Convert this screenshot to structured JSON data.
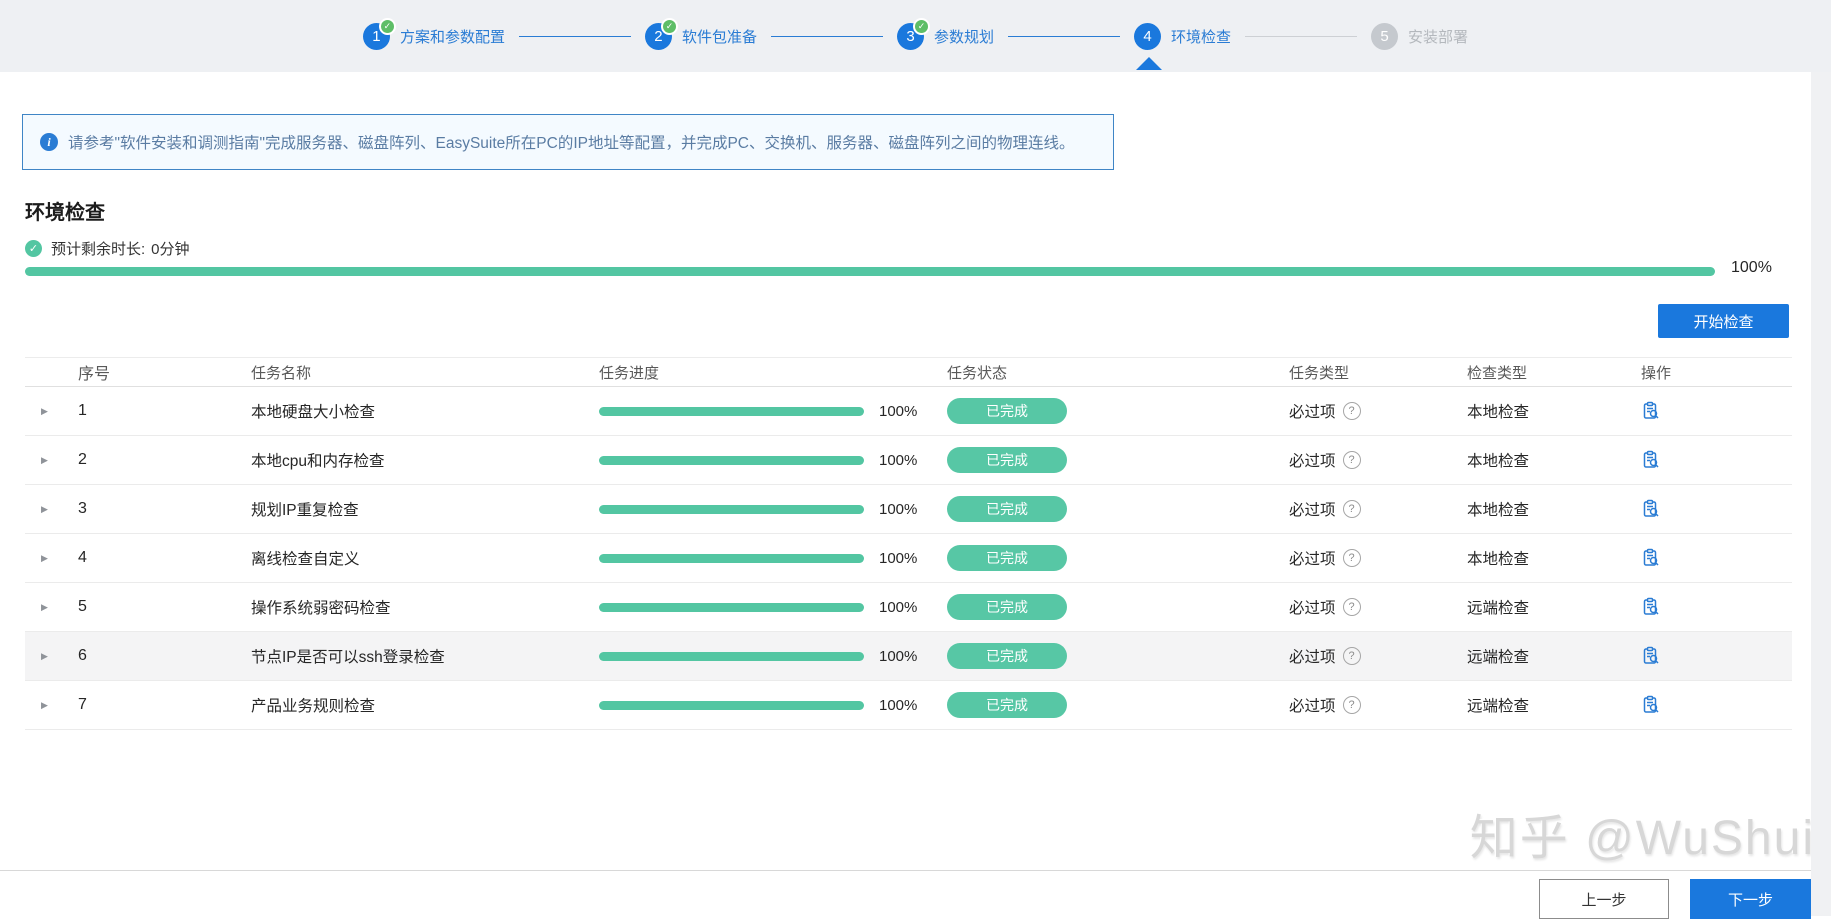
{
  "colors": {
    "primary_blue": "#1a78dd",
    "link_blue": "#2a7cd4",
    "progress_teal": "#53c6a2",
    "badge_teal": "#57c7a5",
    "step_done_green": "#5ebe67",
    "banner_border": "#3f85c6",
    "banner_bg": "#f4faff"
  },
  "stepper": {
    "steps": [
      {
        "num": "1",
        "label": "方案和参数配置",
        "state": "done"
      },
      {
        "num": "2",
        "label": "软件包准备",
        "state": "done"
      },
      {
        "num": "3",
        "label": "参数规划",
        "state": "done"
      },
      {
        "num": "4",
        "label": "环境检查",
        "state": "current"
      },
      {
        "num": "5",
        "label": "安装部署",
        "state": "pending"
      }
    ]
  },
  "banner": {
    "text": "请参考\"软件安装和调测指南\"完成服务器、磁盘阵列、EasySuite所在PC的IP地址等配置，并完成PC、交换机、服务器、磁盘阵列之间的物理连线。"
  },
  "section": {
    "title": "环境检查",
    "remaining_label": "预计剩余时长:",
    "remaining_value": "0分钟",
    "overall_progress": "100%"
  },
  "actions": {
    "start_check": "开始检查"
  },
  "table": {
    "headers": [
      "序号",
      "任务名称",
      "任务进度",
      "任务状态",
      "任务类型",
      "检查类型",
      "操作"
    ],
    "rows": [
      {
        "no": "1",
        "name": "本地硬盘大小检查",
        "progress": "100%",
        "status": "已完成",
        "type": "必过项",
        "check_type": "本地检查"
      },
      {
        "no": "2",
        "name": "本地cpu和内存检查",
        "progress": "100%",
        "status": "已完成",
        "type": "必过项",
        "check_type": "本地检查"
      },
      {
        "no": "3",
        "name": "规划IP重复检查",
        "progress": "100%",
        "status": "已完成",
        "type": "必过项",
        "check_type": "本地检查"
      },
      {
        "no": "4",
        "name": "离线检查自定义",
        "progress": "100%",
        "status": "已完成",
        "type": "必过项",
        "check_type": "本地检查"
      },
      {
        "no": "5",
        "name": "操作系统弱密码检查",
        "progress": "100%",
        "status": "已完成",
        "type": "必过项",
        "check_type": "远端检查"
      },
      {
        "no": "6",
        "name": "节点IP是否可以ssh登录检查",
        "progress": "100%",
        "status": "已完成",
        "type": "必过项",
        "check_type": "远端检查"
      },
      {
        "no": "7",
        "name": "产品业务规则检查",
        "progress": "100%",
        "status": "已完成",
        "type": "必过项",
        "check_type": "远端检查"
      }
    ]
  },
  "footer": {
    "prev": "上一步",
    "next": "下一步"
  },
  "watermark": "知乎 @WuShui"
}
